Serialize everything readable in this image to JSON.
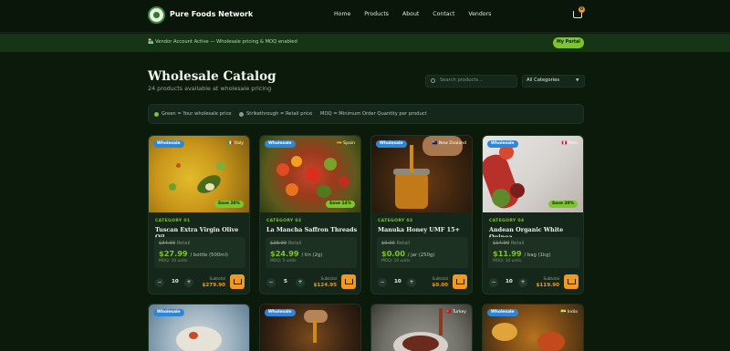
{
  "nav": {
    "brand": "Pure Foods Network",
    "links": [
      "Home",
      "Products",
      "About",
      "Contact",
      "Vendors"
    ],
    "cart_count": "0"
  },
  "banner": {
    "text": "🏪 Vendor Account Active — Wholesale pricing & MOQ enabled",
    "portal_button": "My Portal"
  },
  "catalog": {
    "title": "Wholesale Catalog",
    "subtitle": "24 products available at wholesale pricing",
    "search_placeholder": "Search products...",
    "category_select": "All Categories"
  },
  "legend": {
    "items": [
      "Green = Your wholesale price",
      "Strikethrough = Retail price",
      "MOQ = Minimum Order Quantity per product"
    ],
    "colors": [
      "#7dc52e",
      "#8b9a8b"
    ]
  },
  "products": [
    {
      "tag": "Wholesale",
      "origin": "🇮🇹 Italy",
      "save": "Save 20%",
      "category": "CATEGORY 01",
      "name": "Tuscan Extra Virgin Olive Oil",
      "retail_price": "$34.99",
      "retail_label": "Retail",
      "price": "$27.99",
      "unit": "/ bottle (500ml)",
      "moq": "MOQ: 10 units",
      "qty": "10",
      "subtotal_label": "Subtotal",
      "subtotal": "$279.90",
      "minus": "−",
      "plus": "+"
    },
    {
      "tag": "Wholesale",
      "origin": "🇪🇸 Spain",
      "save": "Save 14%",
      "category": "CATEGORY 02",
      "name": "La Mancha Saffron Threads",
      "retail_price": "$28.99",
      "retail_label": "Retail",
      "price": "$24.99",
      "unit": "/ tin (2g)",
      "moq": "MOQ: 5 units",
      "qty": "5",
      "subtotal_label": "Subtotal",
      "subtotal": "$124.95",
      "minus": "−",
      "plus": "+"
    },
    {
      "tag": "Wholesale",
      "origin": "🇳🇿 New Zealand",
      "save": "",
      "category": "CATEGORY 03",
      "name": "Manuka Honey UMF 15+",
      "retail_price": "$0.00",
      "retail_label": "Retail",
      "price": "$0.00",
      "unit": "/ jar (250g)",
      "moq": "MOQ: 10 units",
      "qty": "10",
      "subtotal_label": "Subtotal",
      "subtotal": "$0.00",
      "minus": "−",
      "plus": "+"
    },
    {
      "tag": "Wholesale",
      "origin": "🇵🇪 Peru",
      "save": "Save 20%",
      "category": "CATEGORY 04",
      "name": "Andean Organic White Quinoa",
      "retail_price": "$14.99",
      "retail_label": "Retail",
      "price": "$11.99",
      "unit": "/ bag (1kg)",
      "moq": "MOQ: 10 units",
      "qty": "10",
      "subtotal_label": "Subtotal",
      "subtotal": "$119.90",
      "minus": "−",
      "plus": "+"
    }
  ],
  "products_row2": [
    {
      "tag": "Wholesale",
      "origin": ""
    },
    {
      "tag": "Wholesale",
      "origin": ""
    },
    {
      "tag": "",
      "origin": "🇹🇷 Turkey"
    },
    {
      "tag": "Wholesale",
      "origin": "🇮🇳 India"
    }
  ]
}
